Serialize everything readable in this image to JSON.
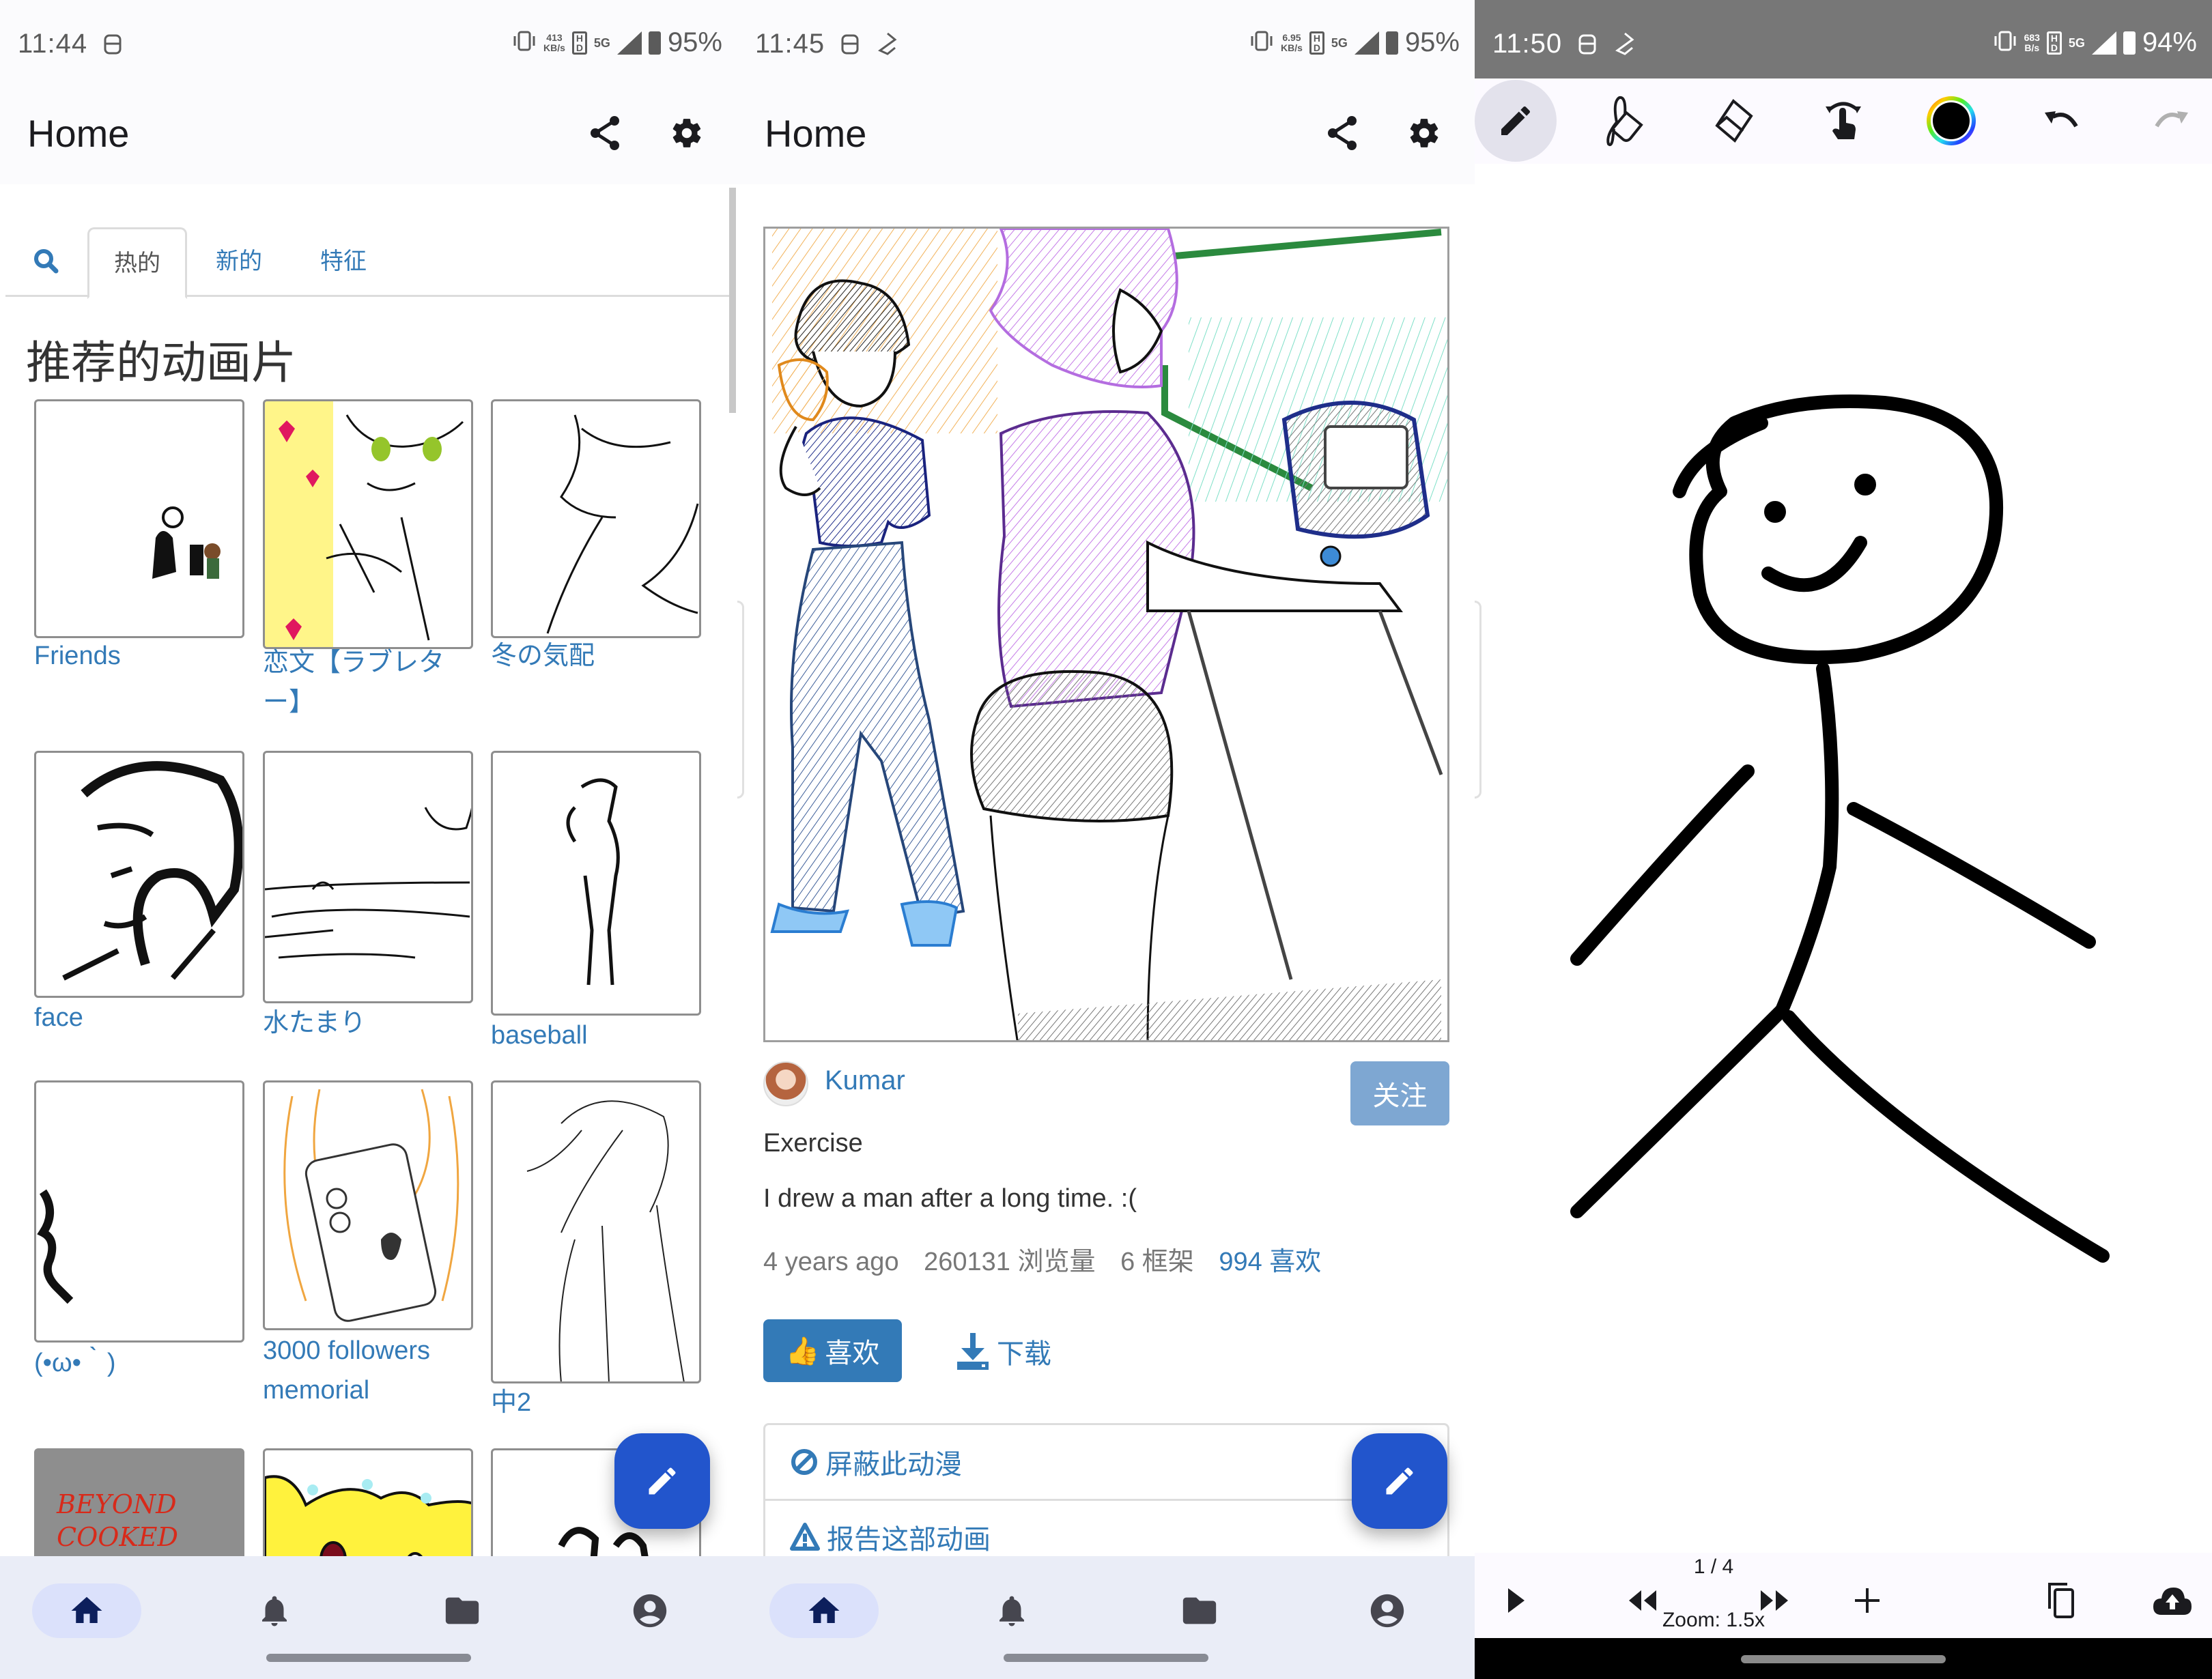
{
  "panels": {
    "feed": {
      "status": {
        "time": "11:44",
        "net_speed": "413",
        "net_unit": "KB/s",
        "network": "5G",
        "battery": "95%"
      },
      "appbar": {
        "title": "Home",
        "share_icon": "share-icon",
        "settings_icon": "gear-icon"
      },
      "tabs": [
        {
          "label": "热的",
          "active": true
        },
        {
          "label": "新的",
          "active": false
        },
        {
          "label": "特征",
          "active": false
        }
      ],
      "section_title": "推荐的动画片",
      "items": [
        {
          "label": "Friends"
        },
        {
          "label": "恋文【ラブレター】"
        },
        {
          "label": "冬の気配"
        },
        {
          "label": "face"
        },
        {
          "label": "水たまり"
        },
        {
          "label": "baseball"
        },
        {
          "label": "(•ω•｀)"
        },
        {
          "label": "3000 followers memorial"
        },
        {
          "label": "中2"
        },
        {
          "label": ""
        },
        {
          "label": ""
        },
        {
          "label": ""
        }
      ],
      "beyond_cooked_text": "BEYOND COOKED",
      "fab_icon": "pencil-icon",
      "bottom_nav": [
        {
          "icon": "home-icon",
          "active": true
        },
        {
          "icon": "bell-icon",
          "active": false
        },
        {
          "icon": "folder-icon",
          "active": false
        },
        {
          "icon": "account-icon",
          "active": false
        }
      ]
    },
    "detail": {
      "status": {
        "time": "11:45",
        "net_speed": "6.95",
        "net_unit": "KB/s",
        "network": "5G",
        "battery": "95%"
      },
      "appbar": {
        "title": "Home"
      },
      "author": "Kumar",
      "follow_label": "关注",
      "title": "Exercise",
      "description": "I drew a man after a long time. :(",
      "meta": {
        "age": "4 years ago",
        "views": "260131 浏览量",
        "frames": "6 框架",
        "likes": "994 喜欢"
      },
      "like_button": {
        "emoji": "👍",
        "label": "喜欢"
      },
      "download_label": "下载",
      "actions": [
        {
          "icon": "block-icon",
          "label": "屏蔽此动漫"
        },
        {
          "icon": "warning-icon",
          "label": "报告这部动画"
        }
      ]
    },
    "editor": {
      "status": {
        "time": "11:50",
        "net_speed": "683",
        "net_unit": "B/s",
        "network": "5G",
        "battery": "94%"
      },
      "tools": [
        {
          "name": "pencil",
          "active": true
        },
        {
          "name": "fill-bucket",
          "active": false
        },
        {
          "name": "eraser",
          "active": false
        },
        {
          "name": "hand-move",
          "active": false
        },
        {
          "name": "color-picker",
          "active": false,
          "color": "#000000"
        },
        {
          "name": "undo",
          "active": false
        },
        {
          "name": "redo",
          "active": false,
          "disabled": true
        }
      ],
      "frame_counter": "1 / 4",
      "zoom_level": "Zoom: 1.5x"
    }
  },
  "colors": {
    "link": "#337ab7",
    "fab": "#2255cc",
    "follow_disabled": "#7ea7d2",
    "bottom_nav_bg": "#eaedf7"
  }
}
